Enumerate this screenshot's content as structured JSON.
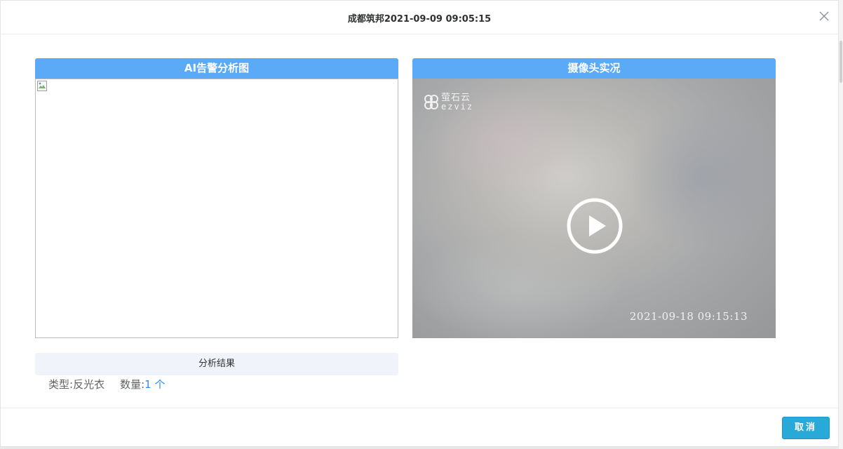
{
  "dialog": {
    "title": "成都筑邦2021-09-09 09:05:15",
    "close_icon": "close-icon"
  },
  "left_panel": {
    "header": "AI告警分析图",
    "image_state": "broken-image-icon"
  },
  "right_panel": {
    "header": "摄像头实况",
    "logo_cn": "萤石云",
    "logo_en": "ezviz",
    "play_icon": "play-circle-icon",
    "timestamp": "2021-09-18 09:15:13"
  },
  "result": {
    "title": "分析结果",
    "type_label": "类型:",
    "type_value": "反光衣",
    "count_label": "数量:",
    "count_value": "1 个"
  },
  "footer": {
    "cancel_label": "取消"
  },
  "colors": {
    "panel_header": "#5aaaf8",
    "cancel_button": "#28a9d8",
    "count_value": "#2d8cf0"
  }
}
